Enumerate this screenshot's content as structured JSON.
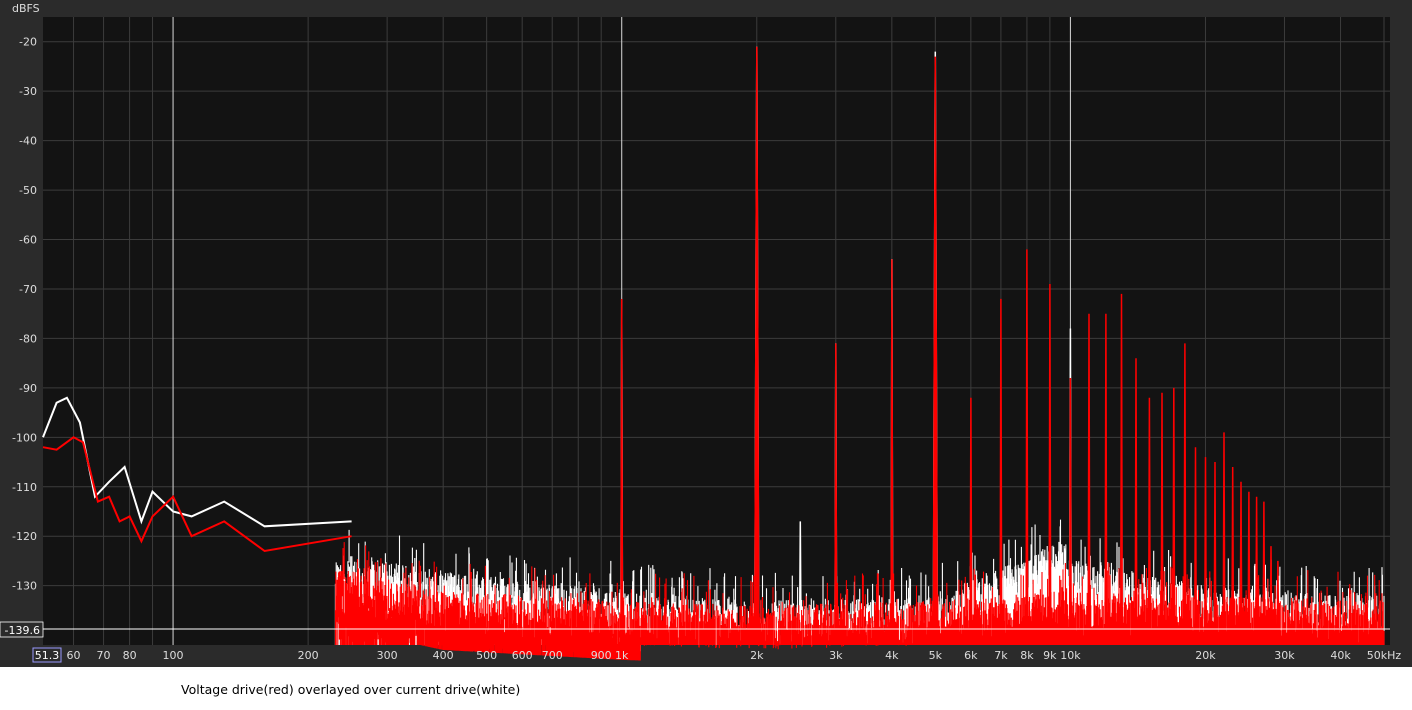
{
  "caption": "Voltage drive(red) overlayed over current drive(white)",
  "colors": {
    "red": "#ff0000",
    "white": "#ffffff",
    "plot_bg": "#131313",
    "frame_bg": "#2b2b2b"
  },
  "cursor_readouts": {
    "x": "51.3",
    "y": "-139.6"
  },
  "chart_data": {
    "type": "line",
    "ylabel": "dBFS",
    "x_scale": "log",
    "xlim": [
      51.3,
      50000
    ],
    "ylim": [
      -142,
      -15
    ],
    "grid": true,
    "y_ticks": [
      "-20",
      "-30",
      "-40",
      "-50",
      "-60",
      "-70",
      "-80",
      "-90",
      "-100",
      "-110",
      "-120",
      "-130"
    ],
    "x_ticks": [
      {
        "v": 60,
        "t": "60"
      },
      {
        "v": 70,
        "t": "70"
      },
      {
        "v": 80,
        "t": "80"
      },
      {
        "v": 100,
        "t": "100"
      },
      {
        "v": 200,
        "t": "200"
      },
      {
        "v": 300,
        "t": "300"
      },
      {
        "v": 400,
        "t": "400"
      },
      {
        "v": 500,
        "t": "500"
      },
      {
        "v": 600,
        "t": "600"
      },
      {
        "v": 700,
        "t": "700"
      },
      {
        "v": 900,
        "t": "900"
      },
      {
        "v": 1000,
        "t": "1k"
      },
      {
        "v": 2000,
        "t": "2k"
      },
      {
        "v": 3000,
        "t": "3k"
      },
      {
        "v": 4000,
        "t": "4k"
      },
      {
        "v": 5000,
        "t": "5k"
      },
      {
        "v": 6000,
        "t": "6k"
      },
      {
        "v": 7000,
        "t": "7k"
      },
      {
        "v": 8000,
        "t": "8k"
      },
      {
        "v": 9000,
        "t": "9k"
      },
      {
        "v": 10000,
        "t": "10k"
      },
      {
        "v": 20000,
        "t": "20k"
      },
      {
        "v": 30000,
        "t": "30k"
      },
      {
        "v": 40000,
        "t": "40k"
      },
      {
        "v": 50000,
        "t": "50kHz"
      }
    ],
    "series": [
      {
        "color": "#ff0000",
        "low_freq_trace": [
          [
            51.3,
            -102
          ],
          [
            55,
            -102.5
          ],
          [
            60,
            -100
          ],
          [
            63,
            -101
          ],
          [
            68,
            -113
          ],
          [
            72,
            -112
          ],
          [
            76,
            -117
          ],
          [
            80,
            -116
          ],
          [
            85,
            -121
          ],
          [
            90,
            -116
          ],
          [
            100,
            -112
          ],
          [
            110,
            -120
          ],
          [
            130,
            -117
          ],
          [
            160,
            -123
          ],
          [
            250,
            -120
          ]
        ],
        "peaks": [
          [
            1000,
            -72
          ],
          [
            2000,
            -21
          ],
          [
            3000,
            -81
          ],
          [
            4000,
            -64
          ],
          [
            5000,
            -23
          ],
          [
            6000,
            -92
          ],
          [
            7000,
            -72
          ],
          [
            8000,
            -62
          ],
          [
            9000,
            -69
          ],
          [
            10000,
            -88
          ],
          [
            11000,
            -75
          ],
          [
            12000,
            -75
          ],
          [
            13000,
            -71
          ],
          [
            14000,
            -84
          ],
          [
            15000,
            -92
          ],
          [
            16000,
            -91
          ],
          [
            17000,
            -90
          ],
          [
            18000,
            -81
          ],
          [
            19000,
            -102
          ],
          [
            20000,
            -104
          ],
          [
            21000,
            -105
          ],
          [
            22000,
            -99
          ],
          [
            23000,
            -106
          ],
          [
            24000,
            -109
          ],
          [
            25000,
            -111
          ],
          [
            26000,
            -112
          ],
          [
            27000,
            -113
          ],
          [
            28000,
            -122
          ],
          [
            29000,
            -125
          ]
        ],
        "noise_floor": [
          [
            100,
            -124
          ],
          [
            250,
            -127
          ],
          [
            400,
            -131
          ],
          [
            1000,
            -133
          ],
          [
            2000,
            -134
          ],
          [
            5000,
            -133
          ],
          [
            10000,
            -131
          ],
          [
            20000,
            -132
          ],
          [
            50000,
            -133
          ]
        ]
      },
      {
        "color": "#ffffff",
        "low_freq_trace": [
          [
            51.3,
            -100
          ],
          [
            55,
            -93
          ],
          [
            58,
            -92
          ],
          [
            62,
            -97
          ],
          [
            67,
            -112
          ],
          [
            72,
            -109
          ],
          [
            78,
            -106
          ],
          [
            85,
            -117
          ],
          [
            90,
            -111
          ],
          [
            100,
            -115
          ],
          [
            110,
            -116
          ],
          [
            130,
            -113
          ],
          [
            160,
            -118
          ],
          [
            250,
            -117
          ]
        ],
        "peaks": [
          [
            1000,
            -72
          ],
          [
            2000,
            -21
          ],
          [
            2500,
            -117
          ],
          [
            3000,
            -81
          ],
          [
            4000,
            -64
          ],
          [
            5000,
            -22
          ],
          [
            10000,
            -78
          ]
        ],
        "noise_floor": [
          [
            100,
            -121
          ],
          [
            250,
            -124
          ],
          [
            400,
            -127
          ],
          [
            1000,
            -131
          ],
          [
            2000,
            -133
          ],
          [
            5000,
            -132
          ],
          [
            9500,
            -121
          ],
          [
            10500,
            -125
          ],
          [
            20000,
            -130
          ],
          [
            50000,
            -132
          ]
        ]
      }
    ]
  }
}
